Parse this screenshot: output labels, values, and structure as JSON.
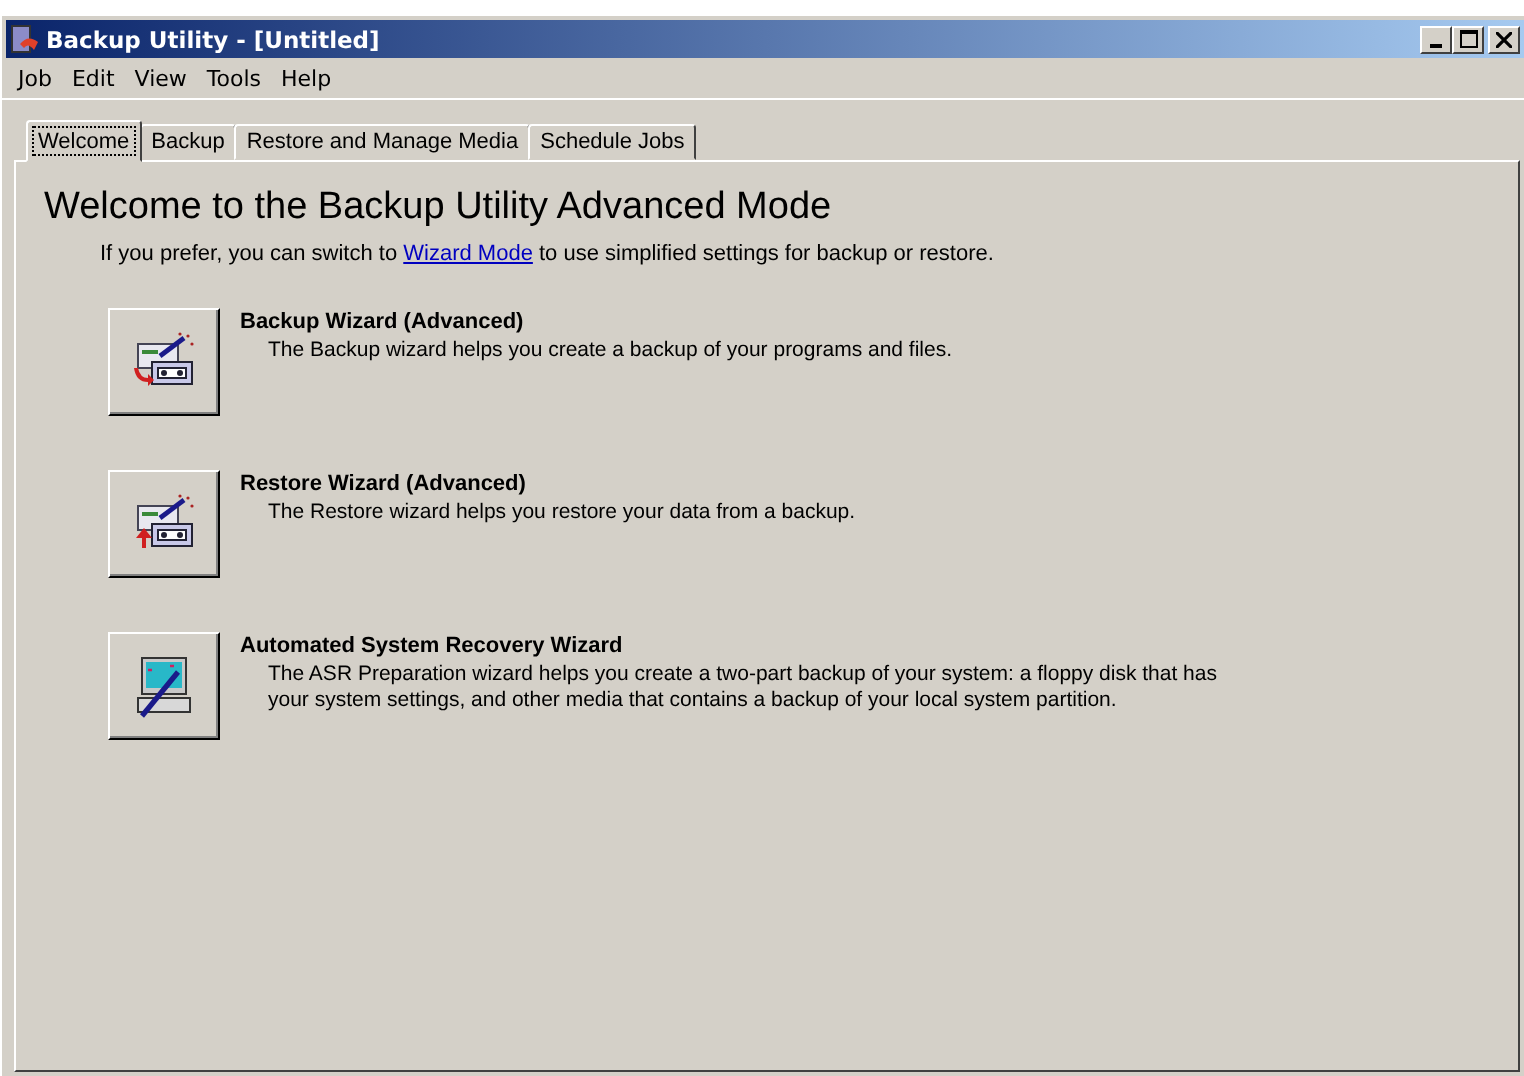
{
  "window": {
    "title": "Backup Utility - [Untitled]"
  },
  "menu": [
    "Job",
    "Edit",
    "View",
    "Tools",
    "Help"
  ],
  "tabs": [
    {
      "label": "Welcome",
      "selected": true
    },
    {
      "label": "Backup",
      "selected": false
    },
    {
      "label": "Restore and Manage Media",
      "selected": false
    },
    {
      "label": "Schedule Jobs",
      "selected": false
    }
  ],
  "heading": "Welcome to the Backup Utility Advanced Mode",
  "intro": {
    "before": "If you prefer, you can switch to",
    "link": "Wizard Mode",
    "after": "to use simplified settings for backup or restore."
  },
  "wizards": [
    {
      "kind": "backup",
      "title": "Backup Wizard (Advanced)",
      "description": "The Backup wizard helps you create a backup of your programs and files."
    },
    {
      "kind": "restore",
      "title": "Restore Wizard (Advanced)",
      "description": "The Restore wizard helps you restore your data from a backup."
    },
    {
      "kind": "asr",
      "title": "Automated System Recovery Wizard",
      "description": "The ASR Preparation wizard helps you create a two-part backup of your system: a floppy disk that has your system settings, and other media that contains a backup of your local system partition."
    }
  ]
}
